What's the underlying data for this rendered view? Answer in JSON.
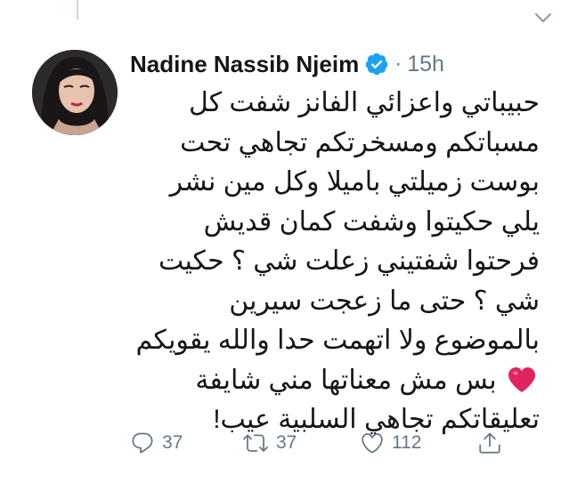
{
  "tweet": {
    "author": {
      "name": "Nadine Nassib Njeim",
      "verified": true
    },
    "separator": "·",
    "time": "15h",
    "text_parts": {
      "before_heart": "حبيباتي واعزائي الفانز شفت كل مسباتكم ومسخرتكم تجاهي تحت بوست زميلتي باميلا وكل مين نشر يلي حكيتوا وشفت كمان قديش فرحتوا شفتيني زعلت شي ؟ حكيت شي ؟ حتى ما زعجت سيرين بالموضوع ولا اتهمت حدا والله يقويكم",
      "after_heart": "بس مش معناتها مني شايفة تعليقاتكم تجاهي السلبية عيب!"
    },
    "actions": {
      "replies": "37",
      "retweets": "37",
      "likes": "112"
    }
  },
  "colors": {
    "text": "#14171a",
    "muted": "#657786",
    "verified": "#1da1f2",
    "heart": "#e0245e",
    "connector": "#ccd6dd"
  },
  "icons": [
    "verified-badge-icon",
    "chevron-down-icon",
    "heart-emoji-icon",
    "reply-icon",
    "retweet-icon",
    "like-icon",
    "share-icon"
  ]
}
